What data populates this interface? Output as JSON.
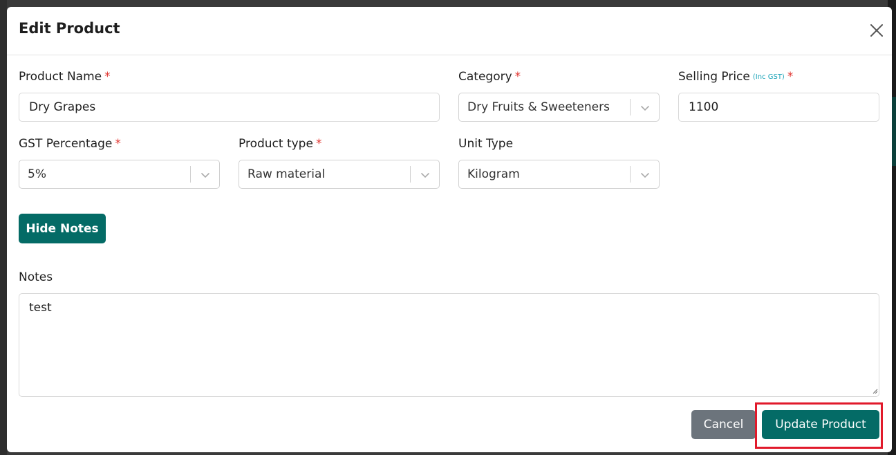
{
  "modal": {
    "title": "Edit Product",
    "close_icon": "close-icon"
  },
  "fields": {
    "product_name": {
      "label": "Product Name",
      "required": "*",
      "value": "Dry Grapes"
    },
    "category": {
      "label": "Category",
      "required": "*",
      "value": "Dry Fruits & Sweeteners"
    },
    "selling_price": {
      "label": "Selling Price",
      "hint": "(Inc GST)",
      "required": "*",
      "value": "1100"
    },
    "gst_percentage": {
      "label": "GST Percentage",
      "required": "*",
      "value": "5%"
    },
    "product_type": {
      "label": "Product type",
      "required": "*",
      "value": "Raw material"
    },
    "unit_type": {
      "label": "Unit Type",
      "value": "Kilogram"
    }
  },
  "notes": {
    "toggle_label": "Hide Notes",
    "label": "Notes",
    "value": "test"
  },
  "footer": {
    "cancel_label": "Cancel",
    "submit_label": "Update Product"
  },
  "colors": {
    "primary": "#046b66",
    "secondary": "#6c747c",
    "required": "#e0312c",
    "highlight": "#e11a2b",
    "hint": "#1ba3b8"
  }
}
